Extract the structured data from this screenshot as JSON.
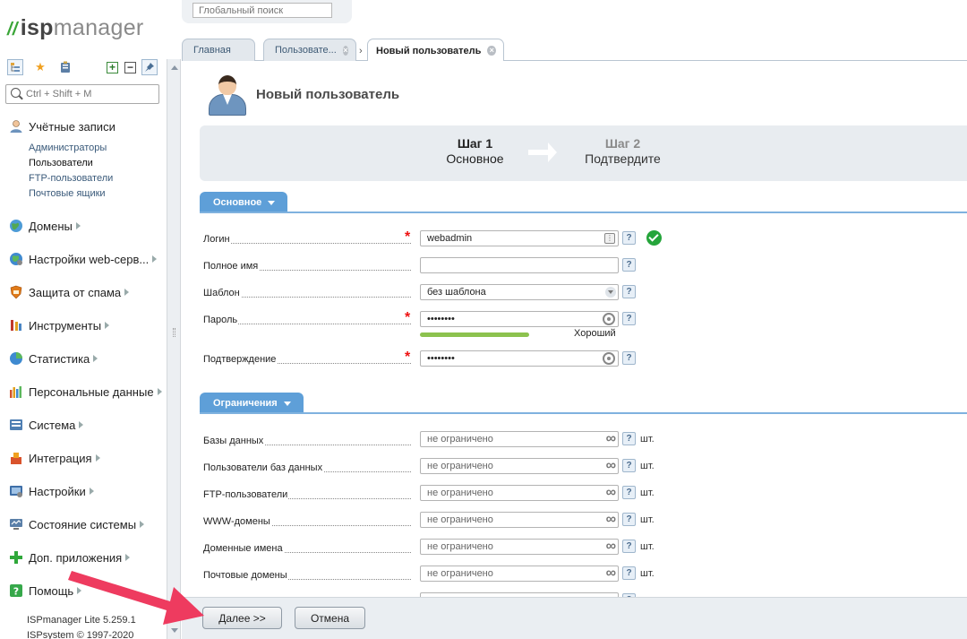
{
  "app": {
    "logo_prefix": "isp",
    "logo_suffix": "manager"
  },
  "global_search": {
    "placeholder": "Глобальный поиск"
  },
  "sidebar": {
    "search_placeholder": "Ctrl + Shift + M",
    "sections": [
      {
        "label": "Учётные записи",
        "icon": "users-icon",
        "color": "#d9a66b"
      },
      {
        "label": "Домены",
        "icon": "globe-icon",
        "color": "#5aa05a"
      },
      {
        "label": "Настройки web-серв...",
        "icon": "web-settings-icon",
        "color": "#4a86c5"
      },
      {
        "label": "Защита от спама",
        "icon": "shield-icon",
        "color": "#e07b1a"
      },
      {
        "label": "Инструменты",
        "icon": "tools-icon",
        "color": "#c0392b"
      },
      {
        "label": "Статистика",
        "icon": "pie-chart-icon",
        "color": "#3e8ad0"
      },
      {
        "label": "Персональные данные",
        "icon": "bar-chart-icon",
        "color": "#d4542b"
      },
      {
        "label": "Система",
        "icon": "system-icon",
        "color": "#4f7fb3"
      },
      {
        "label": "Интеграция",
        "icon": "integration-icon",
        "color": "#d9532c"
      },
      {
        "label": "Настройки",
        "icon": "settings-icon",
        "color": "#3f6fa8"
      },
      {
        "label": "Состояние системы",
        "icon": "monitor-icon",
        "color": "#5a7fa8"
      },
      {
        "label": "Доп. приложения",
        "icon": "plus-icon",
        "color": "#2fa83a"
      },
      {
        "label": "Помощь",
        "icon": "help-icon",
        "color": "#36a84a"
      }
    ],
    "subitems": [
      "Администраторы",
      "Пользователи",
      "FTP-пользователи",
      "Почтовые ящики"
    ],
    "footer": {
      "version": "ISPmanager Lite 5.259.1",
      "copyright": "ISPsystem © 1997-2020"
    }
  },
  "tabs": [
    {
      "label": "Главная"
    },
    {
      "label": "Пользовате..."
    },
    {
      "label": "Новый пользователь"
    }
  ],
  "page": {
    "title": "Новый пользователь"
  },
  "wizard": {
    "step1": {
      "num": "Шаг 1",
      "desc": "Основное"
    },
    "step2": {
      "num": "Шаг 2",
      "desc": "Подтвердите"
    }
  },
  "sections": {
    "basic": "Основное",
    "limits": "Ограничения"
  },
  "form": {
    "login": {
      "label": "Логин",
      "value": "webadmin"
    },
    "fullname": {
      "label": "Полное имя",
      "value": ""
    },
    "template": {
      "label": "Шаблон",
      "value": "без шаблона"
    },
    "password": {
      "label": "Пароль",
      "value": "••••••••",
      "strength": "Хороший",
      "strength_level": 0.55
    },
    "confirm": {
      "label": "Подтверждение",
      "value": "••••••••"
    }
  },
  "limits": [
    {
      "label": "Базы данных",
      "value": "не ограничено",
      "unit": "шт."
    },
    {
      "label": "Пользователи баз данных",
      "value": "не ограничено",
      "unit": "шт."
    },
    {
      "label": "FTP-пользователи",
      "value": "не ограничено",
      "unit": "шт."
    },
    {
      "label": "WWW-домены",
      "value": "не ограничено",
      "unit": "шт."
    },
    {
      "label": "Доменные имена",
      "value": "не ограничено",
      "unit": "шт."
    },
    {
      "label": "Почтовые домены",
      "value": "не ограничено",
      "unit": "шт."
    }
  ],
  "buttons": {
    "next": "Далее >>",
    "cancel": "Отмена"
  },
  "colors": {
    "accent": "#5e9fd8",
    "required": "#ee1111",
    "ok": "#25a53b",
    "arrow": "#ee3b5f"
  }
}
